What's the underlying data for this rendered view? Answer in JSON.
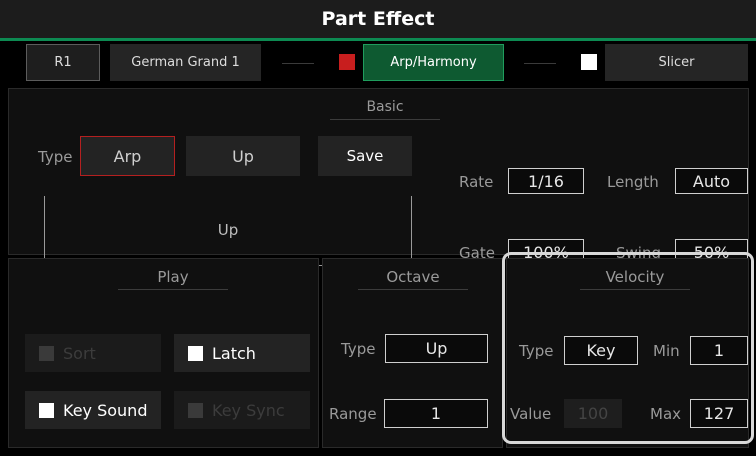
{
  "header": {
    "title": "Part Effect"
  },
  "parts": {
    "part_label": "R1",
    "voice_name": "German Grand 1",
    "arp_button": "Arp/Harmony",
    "slicer_button": "Slicer",
    "colors": {
      "arp_indicator": "#c81e1e",
      "slicer_indicator": "#ffffff",
      "accent": "#0d8a52"
    }
  },
  "basic": {
    "heading": "Basic",
    "type_label": "Type",
    "type_value": "Arp",
    "pattern_value": "Up",
    "save_label": "Save",
    "display_text": "Up",
    "rate_label": "Rate",
    "rate_value": "1/16",
    "length_label": "Length",
    "length_value": "Auto",
    "gate_label": "Gate",
    "gate_value": "100%",
    "swing_label": "Swing",
    "swing_value": "50%"
  },
  "play": {
    "heading": "Play",
    "sort_label": "Sort",
    "sort_enabled": false,
    "latch_label": "Latch",
    "latch_checked": true,
    "key_sound_label": "Key Sound",
    "key_sound_checked": true,
    "key_sync_label": "Key Sync",
    "key_sync_enabled": false
  },
  "octave": {
    "heading": "Octave",
    "type_label": "Type",
    "type_value": "Up",
    "range_label": "Range",
    "range_value": "1"
  },
  "velocity": {
    "heading": "Velocity",
    "type_label": "Type",
    "type_value": "Key",
    "min_label": "Min",
    "min_value": "1",
    "value_label": "Value",
    "value_value": "100",
    "max_label": "Max",
    "max_value": "127"
  }
}
